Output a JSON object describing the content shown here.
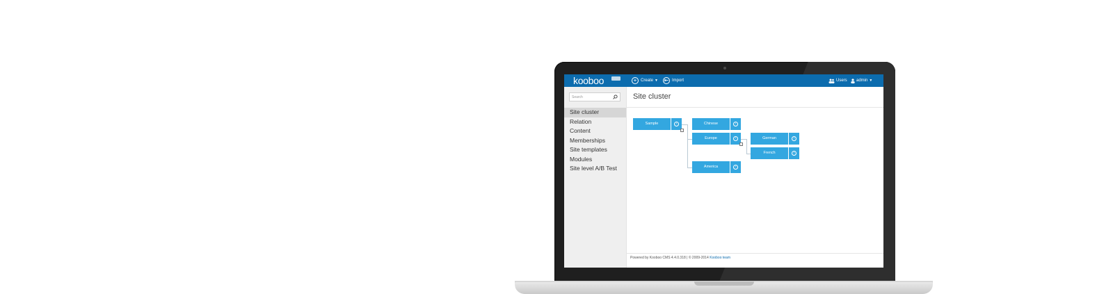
{
  "app": {
    "logo_text": "kooboo",
    "brand_color": "#0c6cae",
    "node_color": "#33a7e0"
  },
  "topbar": {
    "create_label": "Create",
    "import_label": "Import",
    "users_label": "Users",
    "admin_label": "admin"
  },
  "sidebar": {
    "search_placeholder": "Search",
    "items": [
      {
        "label": "Site cluster",
        "active": true
      },
      {
        "label": "Relation"
      },
      {
        "label": "Content"
      },
      {
        "label": "Memberships"
      },
      {
        "label": "Site templates"
      },
      {
        "label": "Modules"
      },
      {
        "label": "Site level A/B Test"
      }
    ]
  },
  "main": {
    "title": "Site cluster",
    "tree": {
      "root": "Sample",
      "children": [
        "Chinese",
        "Europe",
        "America"
      ],
      "europe_children": [
        "German",
        "French"
      ]
    }
  },
  "footer": {
    "text": "Powered by Kooboo CMS 4.4.0.318 | © 2009-2014",
    "link": "Kooboo team"
  }
}
